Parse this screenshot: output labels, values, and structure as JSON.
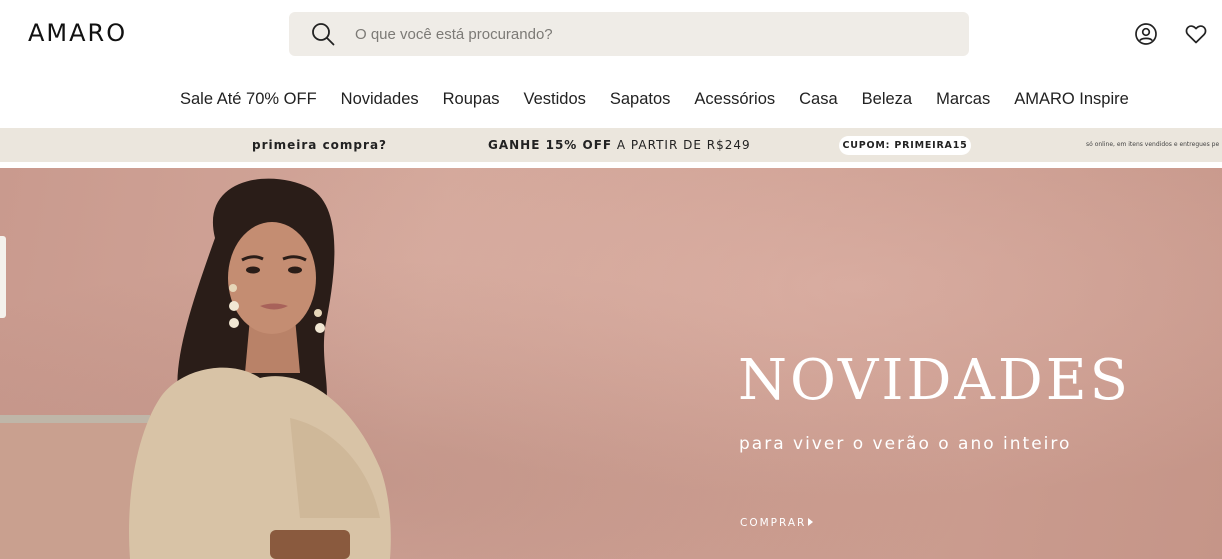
{
  "header": {
    "logo": "AMARO",
    "search": {
      "placeholder": "O que você está procurando?",
      "value": "",
      "icon": "search-icon"
    },
    "icons": [
      "user-icon",
      "heart-icon"
    ]
  },
  "nav": {
    "items": [
      {
        "label": "Sale Até 70% OFF"
      },
      {
        "label": "Novidades"
      },
      {
        "label": "Roupas"
      },
      {
        "label": "Vestidos"
      },
      {
        "label": "Sapatos"
      },
      {
        "label": "Acessórios"
      },
      {
        "label": "Casa"
      },
      {
        "label": "Beleza"
      },
      {
        "label": "Marcas"
      },
      {
        "label": "AMARO Inspire"
      }
    ]
  },
  "promo": {
    "question": "primeira compra?",
    "offer_bold": "GANHE 15% OFF",
    "offer_rest": " A PARTIR DE R$249",
    "coupon": "CUPOM: PRIMEIRA15",
    "fine_print": "só online, em itens vendidos e entregues pe"
  },
  "hero": {
    "headline": "NOVIDADES",
    "subline": "para viver o verão o ano inteiro",
    "cta": "COMPRAR"
  },
  "colors": {
    "search_bg": "#efece7",
    "promo_bg": "#ebe6dd",
    "hero_bg": "#cfa194"
  }
}
